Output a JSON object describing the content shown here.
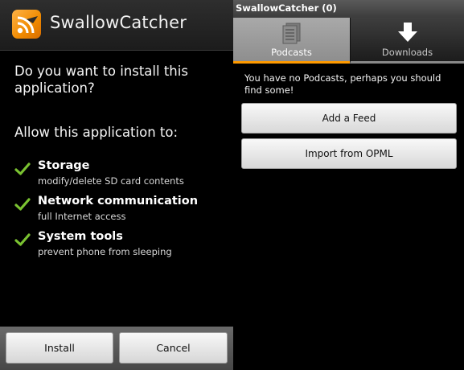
{
  "installer": {
    "app_name": "SwallowCatcher",
    "question": "Do you want to install this application?",
    "allow_heading": "Allow this application to:",
    "permissions": [
      {
        "title": "Storage",
        "description": "modify/delete SD card contents"
      },
      {
        "title": "Network communication",
        "description": "full Internet access"
      },
      {
        "title": "System tools",
        "description": "prevent phone from sleeping"
      }
    ],
    "buttons": {
      "install": "Install",
      "cancel": "Cancel"
    },
    "icons": {
      "app": "rss-feed-icon",
      "permission": "check-icon"
    },
    "colors": {
      "check": "#7ac231",
      "app_icon": "#f08a00"
    }
  },
  "app": {
    "title": "SwallowCatcher (0)",
    "tabs": [
      {
        "label": "Podcasts",
        "icon": "list-icon",
        "selected": true
      },
      {
        "label": "Downloads",
        "icon": "download-arrow-icon",
        "selected": false
      }
    ],
    "empty_message": "You have no Podcasts, perhaps you should find some!",
    "buttons": {
      "add_feed": "Add a Feed",
      "import_opml": "Import from OPML"
    },
    "colors": {
      "tab_indicator": "#ff9a00"
    }
  }
}
